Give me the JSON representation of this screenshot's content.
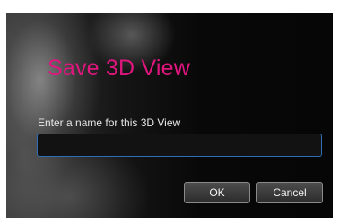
{
  "dialog": {
    "title": "Save 3D View",
    "prompt_label": "Enter a name for this 3D View",
    "name_input": {
      "value": "",
      "placeholder": ""
    },
    "buttons": {
      "ok_label": "OK",
      "cancel_label": "Cancel"
    }
  },
  "colors": {
    "title": "#e0157e",
    "input_border": "#2d6fb2",
    "background": "#080808"
  }
}
